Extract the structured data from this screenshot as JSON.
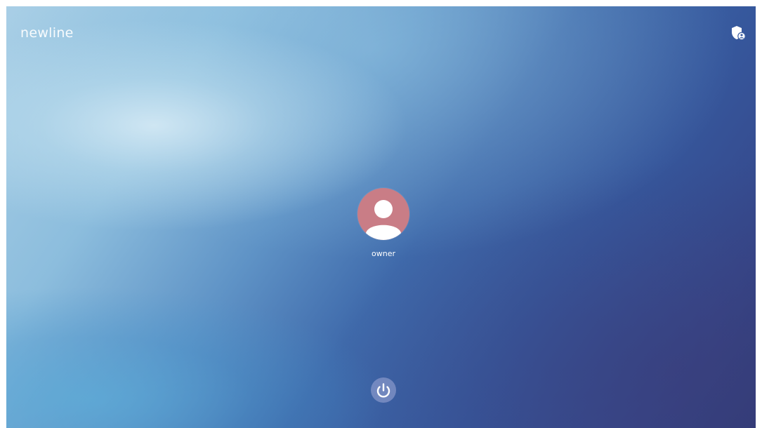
{
  "brand": {
    "logo_text": "newline"
  },
  "users": [
    {
      "name": "owner",
      "avatar_color": "#c97d86"
    }
  ],
  "toolbar": {
    "admin_icon": "shield-user-icon",
    "power_icon": "power-icon"
  },
  "colors": {
    "background_light": "#a9cfe6",
    "background_dark": "#303c78",
    "avatar_bg": "#c97d86"
  }
}
